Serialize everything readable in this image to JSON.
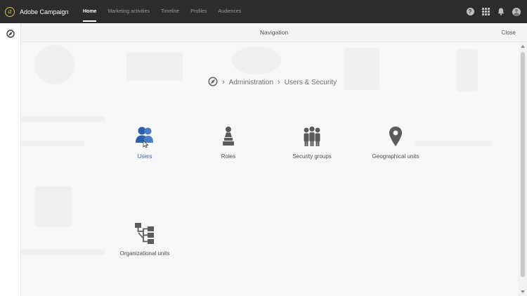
{
  "app": {
    "name": "Adobe Campaign",
    "logo_glyph": "a"
  },
  "topnav": {
    "tabs": [
      {
        "label": "Home",
        "active": true
      },
      {
        "label": "Marketing activities",
        "active": false
      },
      {
        "label": "Timeline",
        "active": false
      },
      {
        "label": "Profiles",
        "active": false
      },
      {
        "label": "Audiences",
        "active": false
      }
    ],
    "help_glyph": "?",
    "icons": [
      "help-icon",
      "apps-grid-icon",
      "bell-icon",
      "avatar"
    ]
  },
  "panel": {
    "title": "Navigation",
    "close_label": "Close"
  },
  "breadcrumb": {
    "home_icon": "compass-icon",
    "separator": "›",
    "items": [
      "Administration",
      "Users & Security"
    ]
  },
  "tiles": [
    {
      "label": "Users",
      "icon": "users-icon",
      "selected": true
    },
    {
      "label": "Roles",
      "icon": "roles-icon",
      "selected": false
    },
    {
      "label": "Security groups",
      "icon": "security-groups-icon",
      "selected": false
    },
    {
      "label": "Geographical units",
      "icon": "location-pin-icon",
      "selected": false
    },
    {
      "label": "Organizational units",
      "icon": "org-units-icon",
      "selected": false
    }
  ],
  "colors": {
    "topbar": "#2c2c2c",
    "accent": "#2d5fab",
    "icon_gray": "#5b5b5b",
    "brand_gold": "#d8c24a"
  }
}
